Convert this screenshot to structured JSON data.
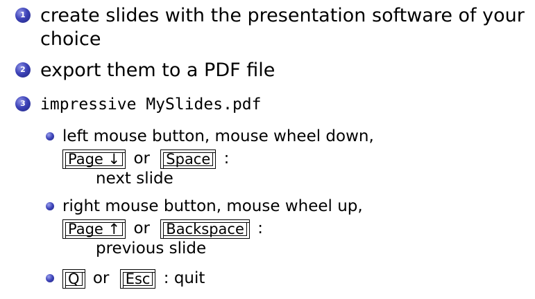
{
  "items": [
    {
      "number": "1",
      "text": "create slides with the presentation software of your",
      "text_cont": "choice"
    },
    {
      "number": "2",
      "text": "export them to a PDF file"
    },
    {
      "number": "3",
      "text": "impressive MySlides.pdf"
    }
  ],
  "subitems": [
    {
      "line1": "left mouse button, mouse wheel down,",
      "key1": "Page ↓",
      "or": "or",
      "key2": "Space",
      "colon": ":",
      "action": "next slide"
    },
    {
      "line1": "right mouse button, mouse wheel up,",
      "key1": "Page ↑",
      "or": "or",
      "key2": "Backspace",
      "colon": ":",
      "action": "previous slide"
    },
    {
      "key1": "Q",
      "or": "or",
      "key2": "Esc",
      "colon": ": quit"
    }
  ],
  "colors": {
    "ball_blue": "#3d43b8",
    "text": "#000000"
  }
}
